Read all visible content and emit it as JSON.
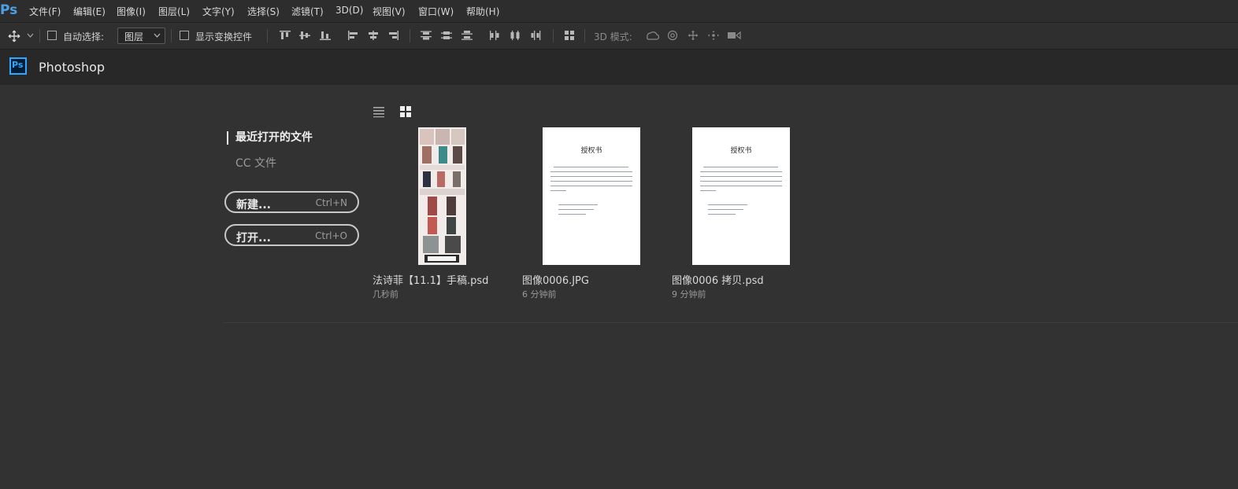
{
  "app": {
    "logo": "Ps",
    "title": "Photoshop"
  },
  "menu": [
    {
      "label": "文件(F)"
    },
    {
      "label": "编辑(E)"
    },
    {
      "label": "图像(I)"
    },
    {
      "label": "图层(L)"
    },
    {
      "label": "文字(Y)"
    },
    {
      "label": "选择(S)"
    },
    {
      "label": "滤镜(T)"
    },
    {
      "label": "3D(D)"
    },
    {
      "label": "视图(V)"
    },
    {
      "label": "窗口(W)"
    },
    {
      "label": "帮助(H)"
    }
  ],
  "options": {
    "move_tool_icon": "move-icon",
    "auto_select_label": "自动选择:",
    "auto_select_checked": false,
    "layer_select_value": "图层",
    "show_transform_label": "显示变换控件",
    "show_transform_checked": false,
    "mode_3d_label": "3D 模式:"
  },
  "sidebar": {
    "recent_label": "最近打开的文件",
    "cc_label": "CC 文件",
    "new_button": {
      "label": "新建...",
      "shortcut": "Ctrl+N"
    },
    "open_button": {
      "label": "打开...",
      "shortcut": "Ctrl+O"
    }
  },
  "view": {
    "list_icon": "list-view-icon",
    "grid_icon": "grid-view-icon",
    "active": "grid"
  },
  "recent_files": [
    {
      "name": "法诗菲【11.1】手稿.psd",
      "time": "几秒前"
    },
    {
      "name": "图像0006.JPG",
      "time": "6 分钟前",
      "doc_title": "授权书"
    },
    {
      "name": "图像0006 拷贝.psd",
      "time": "9 分钟前",
      "doc_title": "授权书"
    }
  ],
  "colors": {
    "accent": "#31a8ff",
    "background": "#323232",
    "menubar": "#2d2d2d"
  }
}
